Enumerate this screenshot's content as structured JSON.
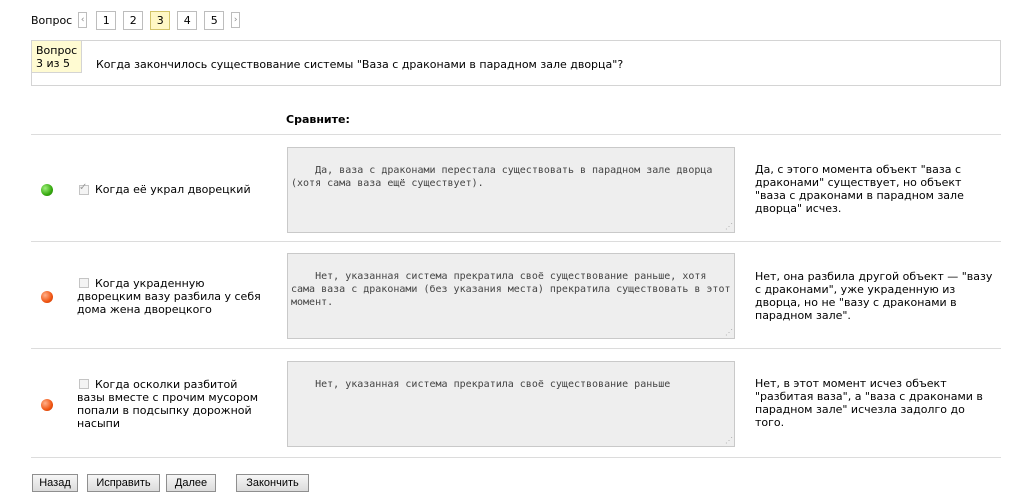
{
  "pager": {
    "label": "Вопрос",
    "prev": "‹",
    "next": "›",
    "pages": [
      "1",
      "2",
      "3",
      "4",
      "5"
    ],
    "active_page": "3"
  },
  "question": {
    "badge_line1": "Вопрос",
    "badge_line2": "3 из 5",
    "text": "Когда закончилось существование системы \"Ваза с драконами в парадном зале дворца\"?"
  },
  "compare_header": "Сравните:",
  "answers": [
    {
      "status": "correct",
      "checked": true,
      "label": "Когда её украл дворецкий",
      "response": "Да, ваза с драконами перестала существовать в парадном зале дворца (хотя сама ваза ещё существует).",
      "explanation": "Да, с этого момента объект \"ваза с драконами\" существует, но объект \"ваза с драконами в парадном зале дворца\" исчез."
    },
    {
      "status": "wrong",
      "checked": false,
      "label": "Когда украденную дворецким вазу разбила у себя дома жена дворецкого",
      "response": "Нет, указанная система прекратила своё существование раньше, хотя сама ваза с драконами (без указания места) прекратила существовать в этот момент.",
      "explanation": "Нет, она разбила другой объект — \"вазу с драконами\", уже украденную из дворца, но не \"вазу с драконами в парадном зале\"."
    },
    {
      "status": "wrong",
      "checked": false,
      "label": "Когда осколки разбитой вазы вместе с прочим мусором попали в подсыпку дорожной насыпи",
      "response": "Нет, указанная система прекратила своё существование раньше",
      "explanation": "Нет, в этот момент исчез объект \"разбитая ваза\", а \"ваза с драконами в парадном зале\" исчезла задолго до того."
    }
  ],
  "buttons": {
    "back": "Назад",
    "fix": "Исправить",
    "next": "Далее",
    "finish": "Закончить"
  },
  "colors": {
    "correct": "#36a90f",
    "wrong": "#f05512",
    "active_page_bg": "#fff8c5"
  }
}
